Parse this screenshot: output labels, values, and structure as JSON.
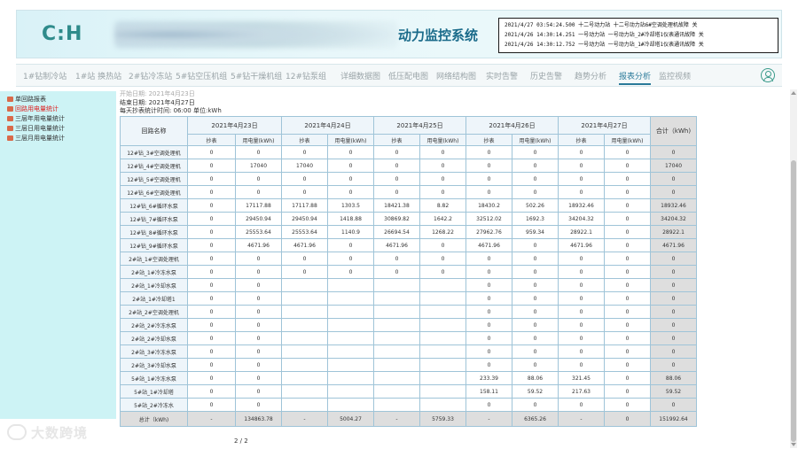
{
  "header": {
    "logo": "C:H",
    "title": "动力监控系统",
    "alarms": [
      "2021/4/27 03:54:24.500 十二号动力站  十二号动力站6#空调处理机故障      关",
      "2021/4/26 14:30:14.251 一号动力站   一号动力站_2#冷却塔1仪表通讯故障  关",
      "2021/4/26 14:30:12.752 一号动力站   一号动力站_1#冷却塔1仪表通讯故障  关"
    ]
  },
  "nav": {
    "items": [
      "1#钻制冷站",
      "1#站 换热站",
      "2#钻冷冻站",
      "5#钻空压机组",
      "5#钻干燥机组",
      "12#钻泵组",
      "详细数据图",
      "低压配电图",
      "网络结构图",
      "实时告警",
      "历史告警",
      "趋势分析",
      "报表分析",
      "监控视频"
    ],
    "active_index": 12
  },
  "sidebar": {
    "items": [
      "单回路报表",
      "回路用电量统计",
      "三层年用电量统计",
      "三层日用电量统计",
      "三层月用电量统计"
    ],
    "active_index": 1
  },
  "info": {
    "line0": "开始日期: 2021年4月23日",
    "line1": "结束日期: 2021年4月27日",
    "line2": "每天抄表统计时间: 06:00 单位:kWh"
  },
  "table": {
    "name_header": "回路名称",
    "dates": [
      "2021年4月23日",
      "2021年4月24日",
      "2021年4月25日",
      "2021年4月26日",
      "2021年4月27日"
    ],
    "sub_headers": [
      "抄表",
      "用电量(kWh)"
    ],
    "total_header": "合计（kWh)",
    "rows": [
      {
        "name": "12#钻_3#空调处理机",
        "cells": [
          "0",
          "0",
          "0",
          "0",
          "0",
          "0",
          "0",
          "0",
          "0",
          "0"
        ],
        "total": "0"
      },
      {
        "name": "12#钻_4#空调处理机",
        "cells": [
          "0",
          "17040",
          "17040",
          "0",
          "0",
          "0",
          "0",
          "0",
          "0",
          "0"
        ],
        "total": "17040"
      },
      {
        "name": "12#钻_5#空调处理机",
        "cells": [
          "0",
          "0",
          "0",
          "0",
          "0",
          "0",
          "0",
          "0",
          "0",
          "0"
        ],
        "total": "0"
      },
      {
        "name": "12#钻_6#空调处理机",
        "cells": [
          "0",
          "0",
          "0",
          "0",
          "0",
          "0",
          "0",
          "0",
          "0",
          "0"
        ],
        "total": "0"
      },
      {
        "name": "12#钻_6#循环水泵",
        "cells": [
          "0",
          "17117.88",
          "17117.88",
          "1303.5",
          "18421.38",
          "8.82",
          "18430.2",
          "502.26",
          "18932.46",
          "0"
        ],
        "total": "18932.46"
      },
      {
        "name": "12#钻_7#循环水泵",
        "cells": [
          "0",
          "29450.94",
          "29450.94",
          "1418.88",
          "30869.82",
          "1642.2",
          "32512.02",
          "1692.3",
          "34204.32",
          "0"
        ],
        "total": "34204.32"
      },
      {
        "name": "12#钻_8#循环水泵",
        "cells": [
          "0",
          "25553.64",
          "25553.64",
          "1140.9",
          "26694.54",
          "1268.22",
          "27962.76",
          "959.34",
          "28922.1",
          "0"
        ],
        "total": "28922.1"
      },
      {
        "name": "12#钻_9#循环水泵",
        "cells": [
          "0",
          "4671.96",
          "4671.96",
          "0",
          "4671.96",
          "0",
          "4671.96",
          "0",
          "4671.96",
          "0"
        ],
        "total": "4671.96"
      },
      {
        "name": "2#站_1#空调处理机",
        "cells": [
          "0",
          "0",
          "0",
          "0",
          "0",
          "0",
          "0",
          "0",
          "0",
          "0"
        ],
        "total": "0"
      },
      {
        "name": "2#站_1#冷冻水泵",
        "cells": [
          "0",
          "0",
          "0",
          "0",
          "0",
          "0",
          "0",
          "0",
          "0",
          "0"
        ],
        "total": "0"
      },
      {
        "name": "2#站_1#冷却水泵",
        "cells": [
          "0",
          "0",
          "",
          "",
          "",
          "",
          "0",
          "0",
          "0",
          "0"
        ],
        "total": "0"
      },
      {
        "name": "2#站_1#冷却塔1",
        "cells": [
          "0",
          "0",
          "",
          "",
          "",
          "",
          "0",
          "0",
          "0",
          "0"
        ],
        "total": "0"
      },
      {
        "name": "2#站_2#空调处理机",
        "cells": [
          "0",
          "0",
          "",
          "",
          "",
          "",
          "0",
          "0",
          "0",
          "0"
        ],
        "total": "0"
      },
      {
        "name": "2#站_2#冷冻水泵",
        "cells": [
          "0",
          "0",
          "",
          "",
          "",
          "",
          "0",
          "0",
          "0",
          "0"
        ],
        "total": "0"
      },
      {
        "name": "2#站_2#冷却水泵",
        "cells": [
          "0",
          "0",
          "",
          "",
          "",
          "",
          "0",
          "0",
          "0",
          "0"
        ],
        "total": "0"
      },
      {
        "name": "2#站_3#冷冻水泵",
        "cells": [
          "0",
          "0",
          "",
          "",
          "",
          "",
          "0",
          "0",
          "0",
          "0"
        ],
        "total": "0"
      },
      {
        "name": "2#站_3#冷却水泵",
        "cells": [
          "0",
          "0",
          "",
          "",
          "",
          "",
          "0",
          "0",
          "0",
          "0"
        ],
        "total": "0"
      },
      {
        "name": "5#站_1#冷冻水泵",
        "cells": [
          "0",
          "0",
          "",
          "",
          "",
          "",
          "233.39",
          "88.06",
          "321.45",
          "0"
        ],
        "total": "88.06"
      },
      {
        "name": "5#站_1#冷却塔",
        "cells": [
          "0",
          "0",
          "",
          "",
          "",
          "",
          "158.11",
          "59.52",
          "217.63",
          "0"
        ],
        "total": "59.52"
      },
      {
        "name": "5#站_2#冷冻水",
        "cells": [
          "0",
          "0",
          "",
          "",
          "",
          "",
          "0",
          "0",
          "0",
          "0"
        ],
        "total": "0"
      }
    ],
    "total_row": {
      "name": "总计（kWh)",
      "cells": [
        "-",
        "134863.78",
        "-",
        "5004.27",
        "-",
        "5759.33",
        "-",
        "6365.26",
        "-",
        "0"
      ],
      "total": "151992.64"
    }
  },
  "pager": "2 /  2"
}
